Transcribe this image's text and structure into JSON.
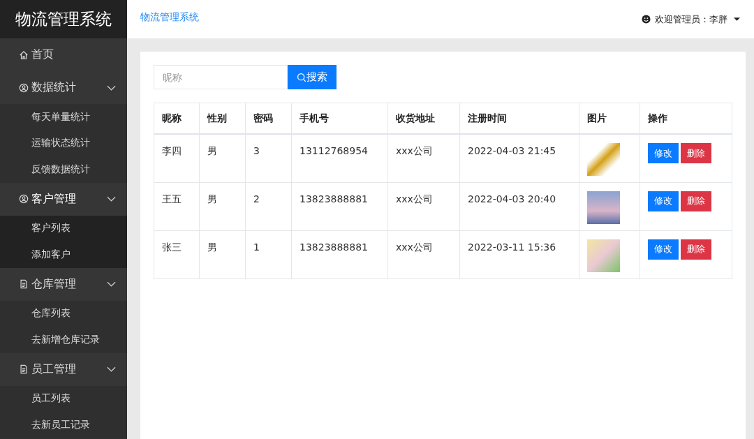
{
  "sidebar": {
    "title": "物流管理系统",
    "items": [
      {
        "label": "首页",
        "selected": false
      },
      {
        "label": "数据统计",
        "expanded": true,
        "selected": false,
        "children": [
          {
            "label": "每天单量统计"
          },
          {
            "label": "运输状态统计"
          },
          {
            "label": "反馈数据统计"
          }
        ]
      },
      {
        "label": "客户管理",
        "expanded": true,
        "selected": true,
        "children": [
          {
            "label": "客户列表"
          },
          {
            "label": "添加客户"
          }
        ]
      },
      {
        "label": "仓库管理",
        "expanded": true,
        "selected": false,
        "children": [
          {
            "label": "仓库列表"
          },
          {
            "label": "去新增仓库记录"
          }
        ]
      },
      {
        "label": "员工管理",
        "expanded": true,
        "selected": false,
        "children": [
          {
            "label": "员工列表"
          },
          {
            "label": "去新员工记录"
          }
        ]
      }
    ]
  },
  "topbar": {
    "link": "物流管理系统",
    "user": "欢迎管理员：李胖"
  },
  "search": {
    "placeholder": "昵称",
    "button": "搜索"
  },
  "table": {
    "columns": [
      "昵称",
      "性别",
      "密码",
      "手机号",
      "收货地址",
      "注册时间",
      "图片",
      "操作"
    ],
    "rows": [
      {
        "cells": [
          "李四",
          "男",
          "3",
          "13112768954",
          "xxx公司",
          "2022-04-03 21:45"
        ],
        "edit": "修改",
        "delete": "删除"
      },
      {
        "cells": [
          "王五",
          "男",
          "2",
          "13823888881",
          "xxx公司",
          "2022-04-03 20:40"
        ],
        "edit": "修改",
        "delete": "删除"
      },
      {
        "cells": [
          "张三",
          "男",
          "1",
          "13823888881",
          "xxx公司",
          "2022-03-11 15:36"
        ],
        "edit": "修改",
        "delete": "删除"
      }
    ]
  }
}
